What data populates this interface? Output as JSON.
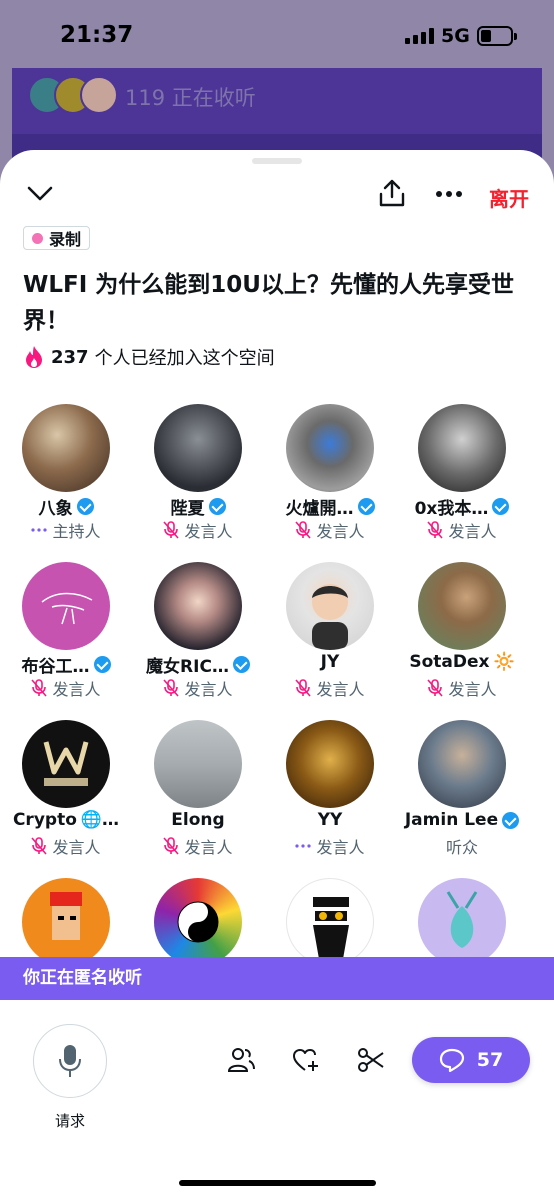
{
  "status_bar": {
    "time": "21:37",
    "network": "5G"
  },
  "background_bar": {
    "listening_text": "119 正在收听"
  },
  "header": {
    "leave_label": "离开"
  },
  "recording_badge": "录制",
  "space_title": "WLFI 为什么能到10U以上？先懂的人先享受世界！",
  "joined": {
    "count": "237",
    "text": "个人已经加入这个空间"
  },
  "participants": [
    {
      "name": "八象",
      "role": "主持人",
      "verified": true,
      "role_icon": "dots-icon"
    },
    {
      "name": "陛夏",
      "role": "发言人",
      "verified": true,
      "role_icon": "mic-off-icon"
    },
    {
      "name": "火爐開…",
      "role": "发言人",
      "verified": true,
      "role_icon": "mic-off-icon"
    },
    {
      "name": "0x我本…",
      "role": "发言人",
      "verified": true,
      "role_icon": "mic-off-icon"
    },
    {
      "name": "布谷工…",
      "role": "发言人",
      "verified": true,
      "role_icon": "mic-off-icon"
    },
    {
      "name": "魔女RIC…",
      "role": "发言人",
      "verified": true,
      "role_icon": "mic-off-icon"
    },
    {
      "name": "JY",
      "role": "发言人",
      "verified": false,
      "role_icon": "mic-off-icon"
    },
    {
      "name": "SotaDex",
      "role": "发言人",
      "verified": false,
      "role_icon": "mic-off-icon",
      "emoji": "🔆"
    },
    {
      "name": "Crypto",
      "role": "发言人",
      "verified": false,
      "role_icon": "mic-off-icon",
      "emoji": "🌐…"
    },
    {
      "name": "Elong",
      "role": "发言人",
      "verified": false,
      "role_icon": "mic-off-icon"
    },
    {
      "name": "YY",
      "role": "发言人",
      "verified": false,
      "role_icon": "dots-icon"
    },
    {
      "name": "Jamin Lee",
      "role": "听众",
      "verified": true,
      "role_icon": ""
    },
    {
      "name": "",
      "role": "",
      "verified": false
    },
    {
      "name": "",
      "role": "",
      "verified": false
    },
    {
      "name": "",
      "role": "",
      "verified": false
    },
    {
      "name": "",
      "role": "",
      "verified": false
    }
  ],
  "anonymous_banner": "你正在匿名收听",
  "bottom_bar": {
    "request_label": "请求",
    "comments_count": "57"
  },
  "colors": {
    "accent": "#7a5cf0",
    "leave": "#f4212e",
    "verified": "#1d9bf0",
    "mic_off": "#f91880"
  }
}
